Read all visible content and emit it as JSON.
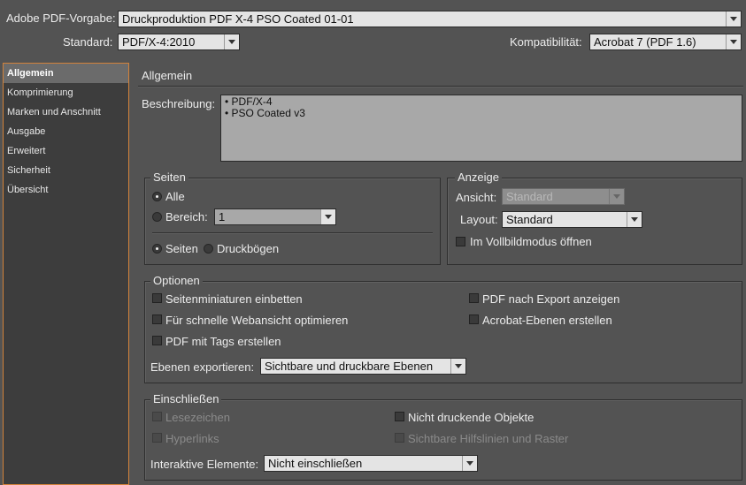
{
  "header": {
    "preset_label": "Adobe PDF-Vorgabe:",
    "preset_value": "Druckproduktion PDF X-4 PSO Coated 01-01",
    "standard_label": "Standard:",
    "standard_value": "PDF/X-4:2010",
    "compat_label": "Kompatibilität:",
    "compat_value": "Acrobat 7 (PDF 1.6)"
  },
  "sidebar": {
    "items": [
      {
        "label": "Allgemein"
      },
      {
        "label": "Komprimierung"
      },
      {
        "label": "Marken und Anschnitt"
      },
      {
        "label": "Ausgabe"
      },
      {
        "label": "Erweitert"
      },
      {
        "label": "Sicherheit"
      },
      {
        "label": "Übersicht"
      }
    ]
  },
  "main": {
    "section_title": "Allgemein",
    "description_label": "Beschreibung:",
    "description_lines": [
      "• PDF/X-4",
      "• PSO Coated v3"
    ]
  },
  "seiten": {
    "title": "Seiten",
    "all_label": "Alle",
    "range_label": "Bereich:",
    "range_value": "1",
    "pages_label": "Seiten",
    "spreads_label": "Druckbögen"
  },
  "anzeige": {
    "title": "Anzeige",
    "view_label": "Ansicht:",
    "view_value": "Standard",
    "layout_label": "Layout:",
    "layout_value": "Standard",
    "fullscreen_label": "Im Vollbildmodus öffnen"
  },
  "optionen": {
    "title": "Optionen",
    "thumbnails_label": "Seitenminiaturen einbetten",
    "fastweb_label": "Für schnelle Webansicht optimieren",
    "tagged_label": "PDF mit Tags erstellen",
    "view_after_label": "PDF nach Export anzeigen",
    "acrobat_layers_label": "Acrobat-Ebenen erstellen",
    "export_layers_label": "Ebenen exportieren:",
    "export_layers_value": "Sichtbare und druckbare Ebenen"
  },
  "include": {
    "title": "Einschließen",
    "bookmarks_label": "Lesezeichen",
    "hyperlinks_label": "Hyperlinks",
    "nonprinting_label": "Nicht druckende Objekte",
    "guides_label": "Sichtbare Hilfslinien und Raster",
    "interactive_label": "Interaktive Elemente:",
    "interactive_value": "Nicht einschließen"
  }
}
